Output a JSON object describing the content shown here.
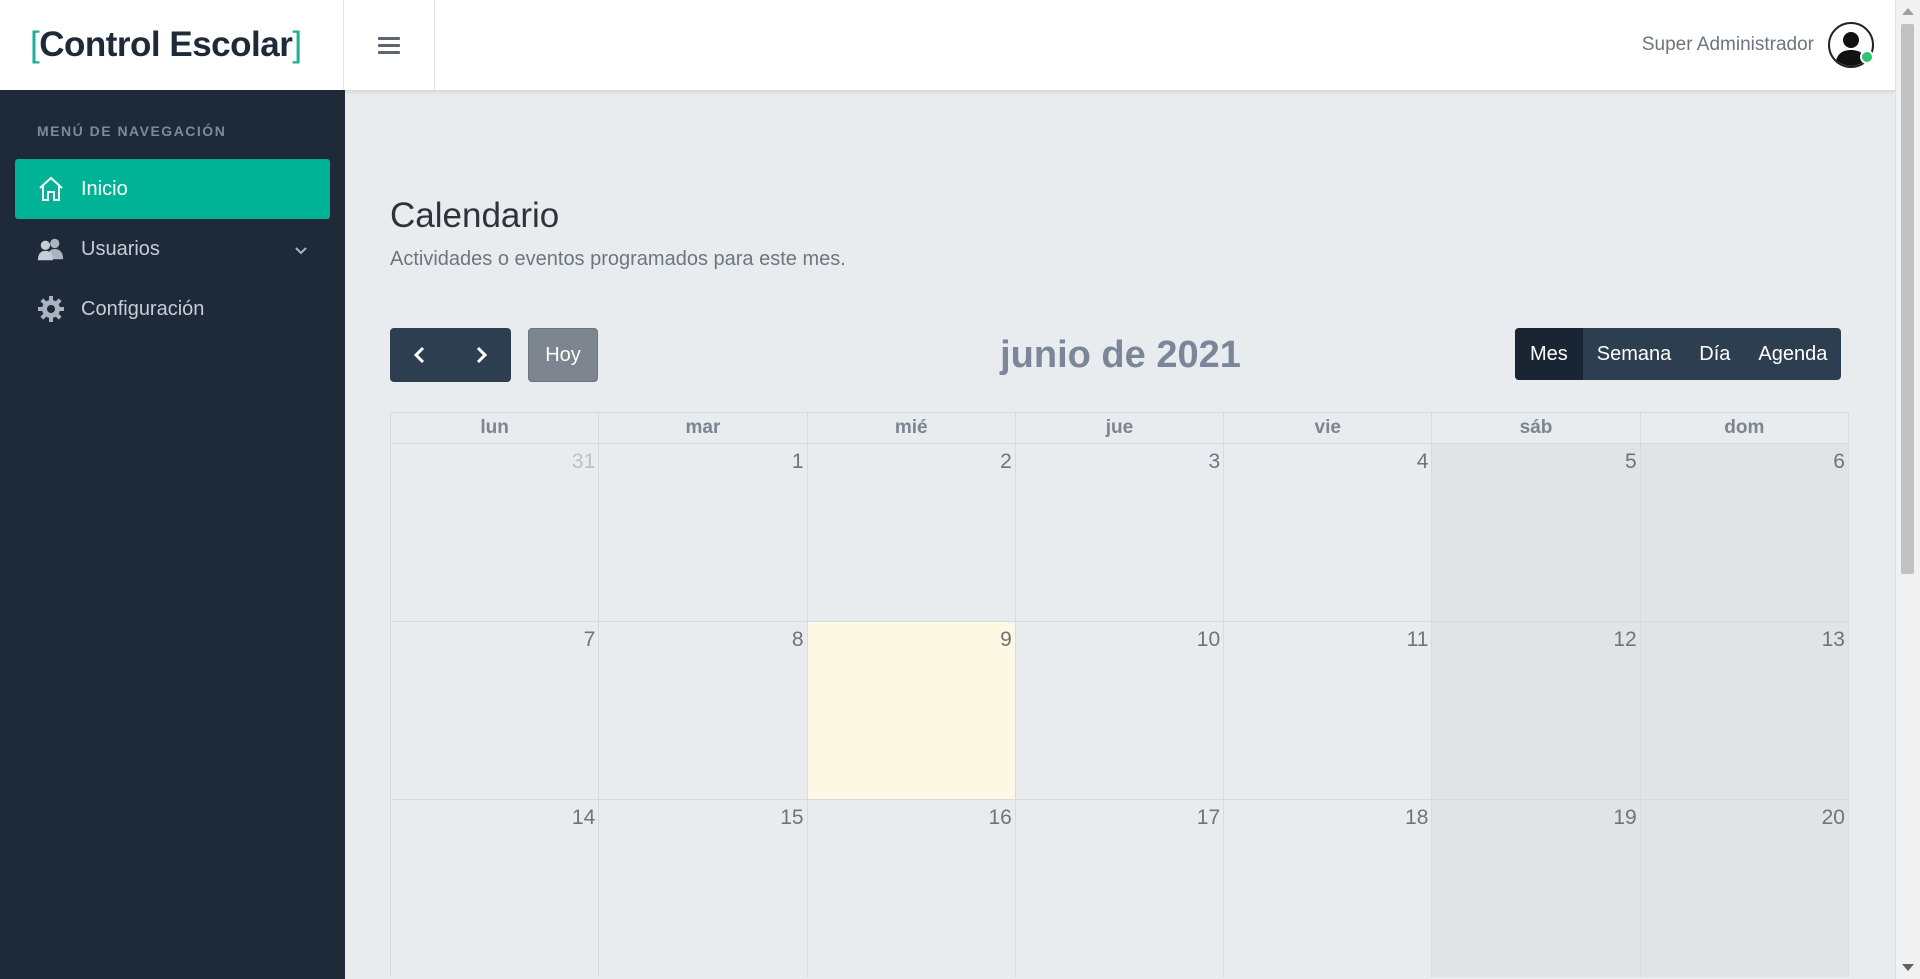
{
  "brand": {
    "open_bracket": "[",
    "name": "Control Escolar",
    "close_bracket": "]"
  },
  "header": {
    "user_name": "Super Administrador"
  },
  "sidebar": {
    "section_title": "MENÚ DE NAVEGACIÓN",
    "items": [
      {
        "label": "Inicio",
        "icon": "home-icon",
        "active": true
      },
      {
        "label": "Usuarios",
        "icon": "users-icon",
        "has_submenu": true
      },
      {
        "label": "Configuración",
        "icon": "gear-icon"
      }
    ]
  },
  "page": {
    "title": "Calendario",
    "subtitle": "Actividades o eventos programados para este mes."
  },
  "calendar": {
    "today_label": "Hoy",
    "month_title": "junio de 2021",
    "views": [
      "Mes",
      "Semana",
      "Día",
      "Agenda"
    ],
    "active_view": "Mes",
    "weekdays": [
      "lun",
      "mar",
      "mié",
      "jue",
      "vie",
      "sáb",
      "dom"
    ],
    "weeks": [
      [
        "31",
        "1",
        "2",
        "3",
        "4",
        "5",
        "6"
      ],
      [
        "7",
        "8",
        "9",
        "10",
        "11",
        "12",
        "13"
      ],
      [
        "14",
        "15",
        "16",
        "17",
        "18",
        "19",
        "20"
      ]
    ],
    "today": "9",
    "other_month_days": [
      "31"
    ]
  },
  "colors": {
    "accent": "#00b396",
    "sidebar_bg": "#1e2a3a",
    "today_bg": "#fcf8e3",
    "weekend_bg": "#e1e4e7"
  }
}
